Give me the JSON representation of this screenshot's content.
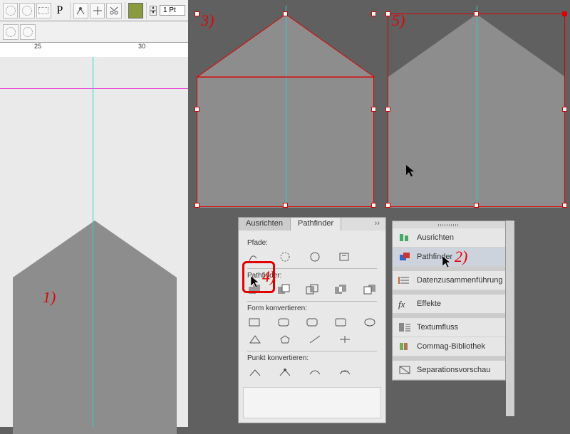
{
  "toolbar": {
    "stroke_value": "1 Pt"
  },
  "ruler": {
    "tick25": "25",
    "tick30": "30"
  },
  "labels": {
    "n1": "1)",
    "n2": "2)",
    "n3": "3)",
    "n4": "4)",
    "n5": "5)"
  },
  "pathfinder_panel": {
    "tab_ausrichten": "Ausrichten",
    "tab_pathfinder": "Pathfinder",
    "sec_pfade": "Pfade:",
    "sec_pathfinder": "Pathfinder:",
    "sec_form_konv": "Form konvertieren:",
    "sec_punkt_konv": "Punkt konvertieren:"
  },
  "side_panel": {
    "ausrichten": "Ausrichten",
    "pathfinder": "Pathfinder",
    "datenzusammen": "Datenzusammenführung",
    "effekte": "Effekte",
    "textumfluss": "Textumfluss",
    "commag": "Commag-Bibliothek",
    "separations": "Separationsvorschau"
  }
}
